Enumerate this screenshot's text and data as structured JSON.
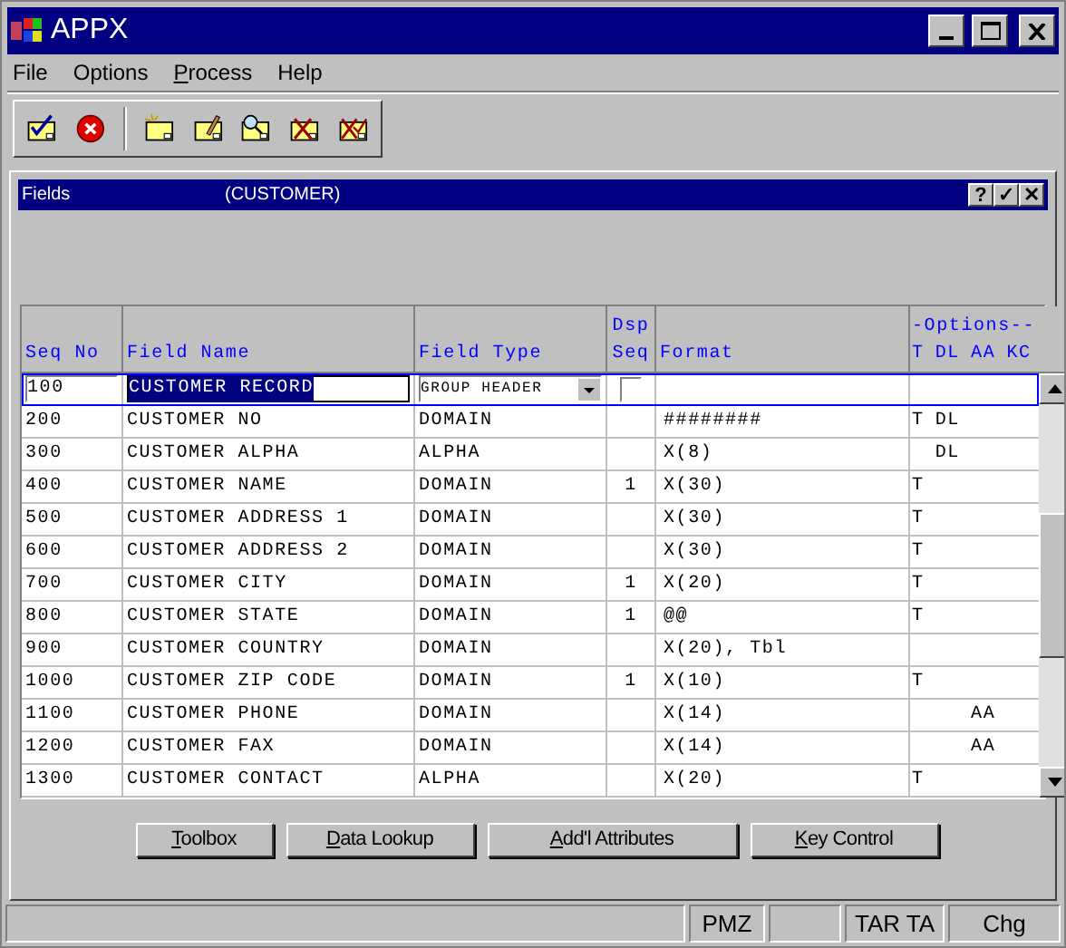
{
  "window": {
    "title": "APPX"
  },
  "menu": [
    {
      "label": "File",
      "underlined": false
    },
    {
      "label": "Options",
      "underlined": false
    },
    {
      "label": "Process",
      "underlined": true
    },
    {
      "label": "Help",
      "underlined": false
    }
  ],
  "toolbar": [
    {
      "kind": "confirm"
    },
    {
      "kind": "cancel"
    },
    {
      "kind": "separator"
    },
    {
      "kind": "new"
    },
    {
      "kind": "edit"
    },
    {
      "kind": "inquire"
    },
    {
      "kind": "delete"
    },
    {
      "kind": "delete-all"
    }
  ],
  "inner_window": {
    "title": "Fields",
    "subtitle": "(CUSTOMER)",
    "buttons": [
      "?",
      "✓",
      "✕"
    ]
  },
  "table": {
    "columns": [
      {
        "label": "Seq No"
      },
      {
        "label": "Field Name"
      },
      {
        "label": "Field Type"
      },
      {
        "label": "Dsp",
        "label_2": "Seq"
      },
      {
        "label": "Format"
      }
    ],
    "options_title": "-Options--",
    "options_columns": [
      "T",
      "DL",
      "AA",
      "KC"
    ],
    "rows": [
      {
        "selected": true,
        "seq": "100",
        "name": "CUSTOMER RECORD",
        "type": "GROUP HEADER",
        "options": {}
      },
      {
        "selected": false,
        "seq": "200",
        "name": "CUSTOMER NO",
        "type": "DOMAIN",
        "format": "########",
        "options": {
          "t": "T",
          "dl": "DL"
        }
      },
      {
        "selected": false,
        "seq": "300",
        "name": "CUSTOMER ALPHA",
        "type": "ALPHA",
        "format": "X(8)",
        "options": {
          "dl": "DL"
        }
      },
      {
        "selected": false,
        "seq": "400",
        "name": "CUSTOMER NAME",
        "type": "DOMAIN",
        "dsp": "1",
        "format": "X(30)",
        "options": {
          "t": "T"
        }
      },
      {
        "selected": false,
        "seq": "500",
        "name": "CUSTOMER ADDRESS 1",
        "type": "DOMAIN",
        "format": "X(30)",
        "options": {
          "t": "T"
        }
      },
      {
        "selected": false,
        "seq": "600",
        "name": "CUSTOMER ADDRESS 2",
        "type": "DOMAIN",
        "format": "X(30)",
        "options": {
          "t": "T"
        }
      },
      {
        "selected": false,
        "seq": "700",
        "name": "CUSTOMER CITY",
        "type": "DOMAIN",
        "dsp": "1",
        "format": "X(20)",
        "options": {
          "t": "T"
        }
      },
      {
        "selected": false,
        "seq": "800",
        "name": "CUSTOMER STATE",
        "type": "DOMAIN",
        "dsp": "1",
        "format": "@@",
        "options": {
          "t": "T"
        }
      },
      {
        "selected": false,
        "seq": "900",
        "name": "CUSTOMER COUNTRY",
        "type": "DOMAIN",
        "format": "X(20), Tbl",
        "options": {}
      },
      {
        "selected": false,
        "seq": "1000",
        "name": "CUSTOMER ZIP CODE",
        "type": "DOMAIN",
        "dsp": "1",
        "format": "X(10)",
        "options": {
          "t": "T"
        }
      },
      {
        "selected": false,
        "seq": "1100",
        "name": "CUSTOMER PHONE",
        "type": "DOMAIN",
        "format": "X(14)",
        "options": {
          "aa": "AA"
        }
      },
      {
        "selected": false,
        "seq": "1200",
        "name": "CUSTOMER FAX",
        "type": "DOMAIN",
        "format": "X(14)",
        "options": {
          "aa": "AA"
        }
      },
      {
        "selected": false,
        "seq": "1300",
        "name": "CUSTOMER CONTACT",
        "type": "ALPHA",
        "format": "X(20)",
        "options": {
          "t": "T"
        }
      }
    ]
  },
  "buttons": [
    "Toolbox",
    "Data Lookup",
    "Add'l Attributes",
    "Key Control"
  ],
  "status_bar": {
    "panel_2": "PMZ",
    "panel_4": "TAR TA",
    "panel_5": "Chg"
  }
}
